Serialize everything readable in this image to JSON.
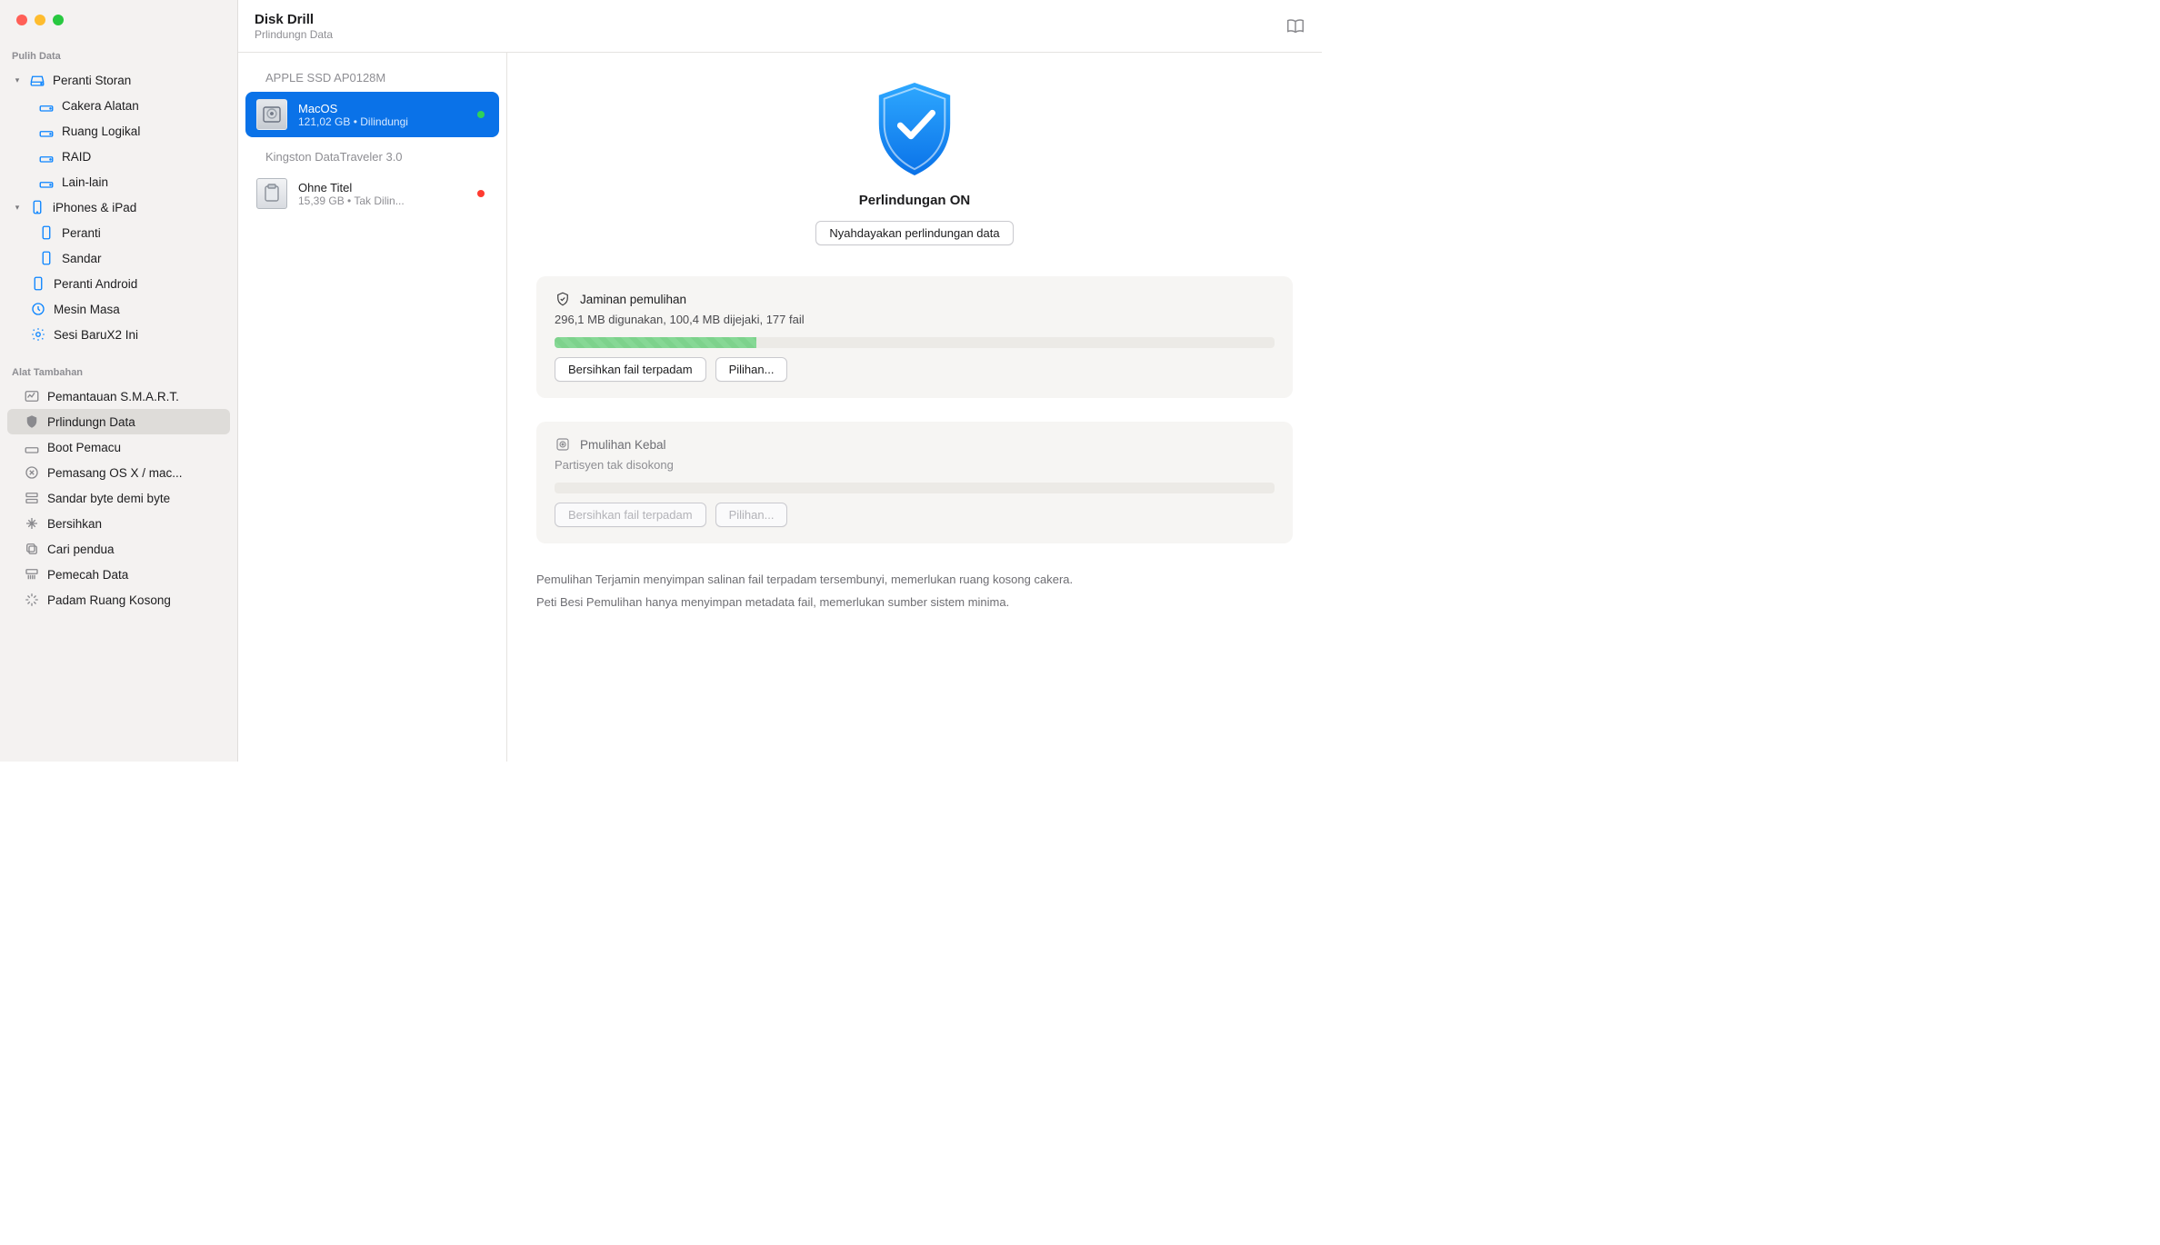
{
  "app": {
    "title": "Disk Drill",
    "subtitle": "Prlindungn Data"
  },
  "sidebar": {
    "section_recover": "Pulih Data",
    "storage_devices": "Peranti Storan",
    "disk_tool": "Cakera Alatan",
    "logical_space": "Ruang Logikal",
    "raid": "RAID",
    "other": "Lain-lain",
    "iphones_ipad": "iPhones & iPad",
    "device": "Peranti",
    "dock": "Sandar",
    "android": "Peranti Android",
    "time_machine": "Mesin Masa",
    "session": "Sesi BaruX2 Ini",
    "section_tools": "Alat Tambahan",
    "smart": "Pemantauan S.M.A.R.T.",
    "data_protect": "Prlindungn Data",
    "boot_drive": "Boot Pemacu",
    "osx_installer": "Pemasang OS X / mac...",
    "byte_backup": "Sandar byte demi byte",
    "cleanup": "Bersihkan",
    "find_dup": "Cari pendua",
    "data_shred": "Pemecah Data",
    "erase_free": "Padam Ruang Kosong"
  },
  "drives": {
    "group1": "APPLE SSD AP0128M",
    "vol1_name": "MacOS",
    "vol1_info": "121,02 GB • Dilindungi",
    "group2": "Kingston DataTraveler 3.0",
    "vol2_name": "Ohne Titel",
    "vol2_info": "15,39 GB • Tak Dilin..."
  },
  "detail": {
    "protection_status": "Perlindungan ON",
    "disable_btn": "Nyahdayakan perlindungan data",
    "card1_title": "Jaminan pemulihan",
    "card1_sub": "296,1 MB digunakan, 100,4 MB dijejaki, 177 fail",
    "card1_btn1": "Bersihkan fail terpadam",
    "card1_btn2": "Pilihan...",
    "card2_title": "Pmulihan Kebal",
    "card2_sub": "Partisyen tak disokong",
    "card2_btn1": "Bersihkan fail terpadam",
    "card2_btn2": "Pilihan...",
    "foot1": "Pemulihan Terjamin menyimpan salinan fail terpadam tersembunyi, memerlukan ruang kosong cakera.",
    "foot2": "Peti Besi Pemulihan hanya menyimpan metadata fail, memerlukan sumber sistem minima."
  }
}
